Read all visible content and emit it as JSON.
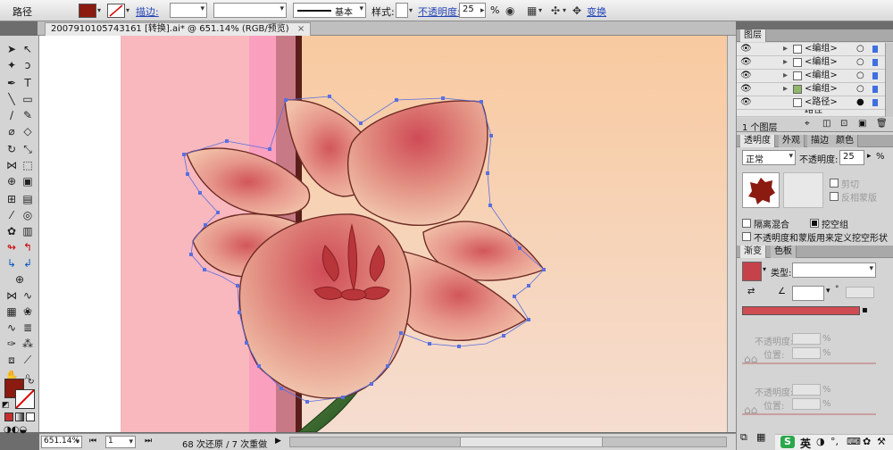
{
  "control_bar": {
    "selection_label": "路径",
    "fill_color": "#8b1a10",
    "stroke_link": "描边:",
    "stroke_style": "基本",
    "style_label": "样式:",
    "opacity_link": "不透明度:",
    "opacity_value": "25",
    "percent": "%",
    "transform_link": "变换"
  },
  "document": {
    "tab_title": "20079101057431​61 [转换].ai* @ 651.14% (RGB/预览)"
  },
  "status": {
    "zoom": "651.14%",
    "page": "1",
    "history": "68 次还原 / 7 次重做"
  },
  "layers_panel": {
    "title": "图层",
    "rows": [
      "<编组>",
      "<编组>",
      "<编组>",
      "<编组>",
      "<路径>",
      "路径"
    ],
    "footer": "1 个图层"
  },
  "transparency_panel": {
    "tabs": [
      "透明度",
      "外观",
      "描边",
      "颜色"
    ],
    "blend_mode": "正常",
    "opacity_label": "不透明度:",
    "opacity_value": "25",
    "clip_label": "剪切",
    "invert_label": "反相蒙版",
    "isolate_label": "隔离混合",
    "knockout_label": "挖空组",
    "define_label": "不透明度和蒙版用来定义挖空形状"
  },
  "gradient_panel": {
    "tabs": [
      "渐变",
      "色板"
    ],
    "type_label": "类型:",
    "opacity_label": "不透明度:",
    "position_label": "位置:",
    "percent": "%",
    "swatch_color": "#c6424a"
  },
  "taskbar": {
    "ime_label": "英"
  },
  "colors": {
    "ui_bg": "#d4d4d4",
    "accent_link": "#2446b8",
    "petal": "#e89a8a",
    "stamen": "#b8353a",
    "artboard_pink": "#f8b8be",
    "artboard_peach": "#f7d2b2"
  }
}
